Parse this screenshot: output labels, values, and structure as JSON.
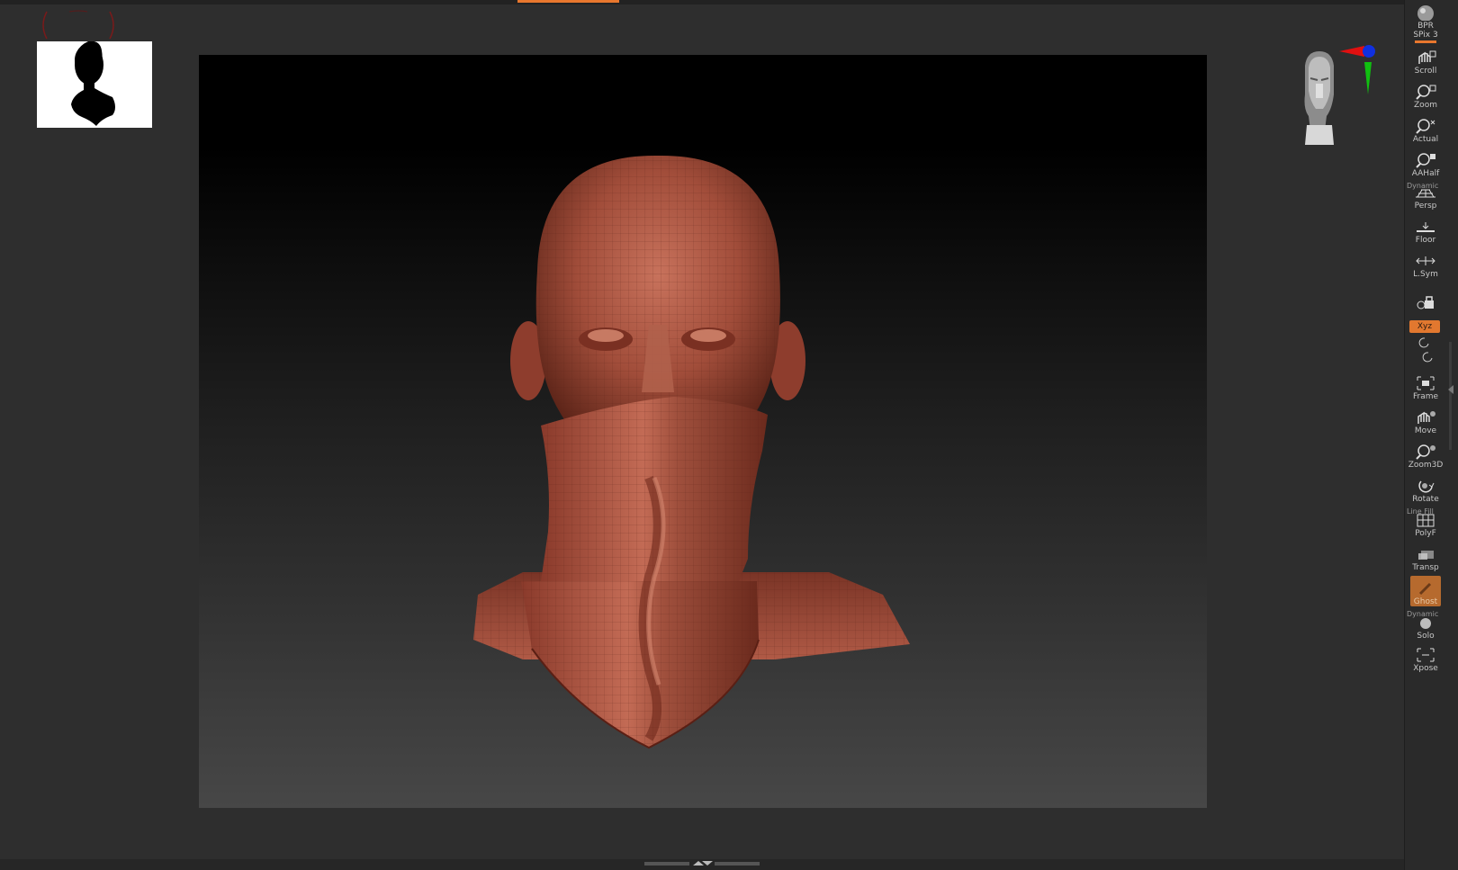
{
  "shelf": {
    "bpr": "BPR",
    "spix": "SPix 3",
    "scroll": "Scroll",
    "zoom": "Zoom",
    "actual": "Actual",
    "aahalf": "AAHalf",
    "persp_caption": "Dynamic",
    "persp": "Persp",
    "floor": "Floor",
    "lsym": "L.Sym",
    "xyz": "Xyz",
    "frame": "Frame",
    "move": "Move",
    "zoom3d": "Zoom3D",
    "rotate": "Rotate",
    "polyf_caption": "Line Fill",
    "polyf": "PolyF",
    "transp": "Transp",
    "ghost": "Ghost",
    "solo_caption": "Dynamic",
    "solo": "Solo",
    "xpose": "Xpose"
  },
  "colors": {
    "accent": "#e8772e",
    "model": "#a94a38",
    "axis_x": "#e01010",
    "axis_y": "#10c010",
    "axis_z": "#1030e0"
  },
  "icons": {
    "thumbnail": "head-silhouette-icon",
    "gizmo": "navigation-head-gizmo"
  }
}
